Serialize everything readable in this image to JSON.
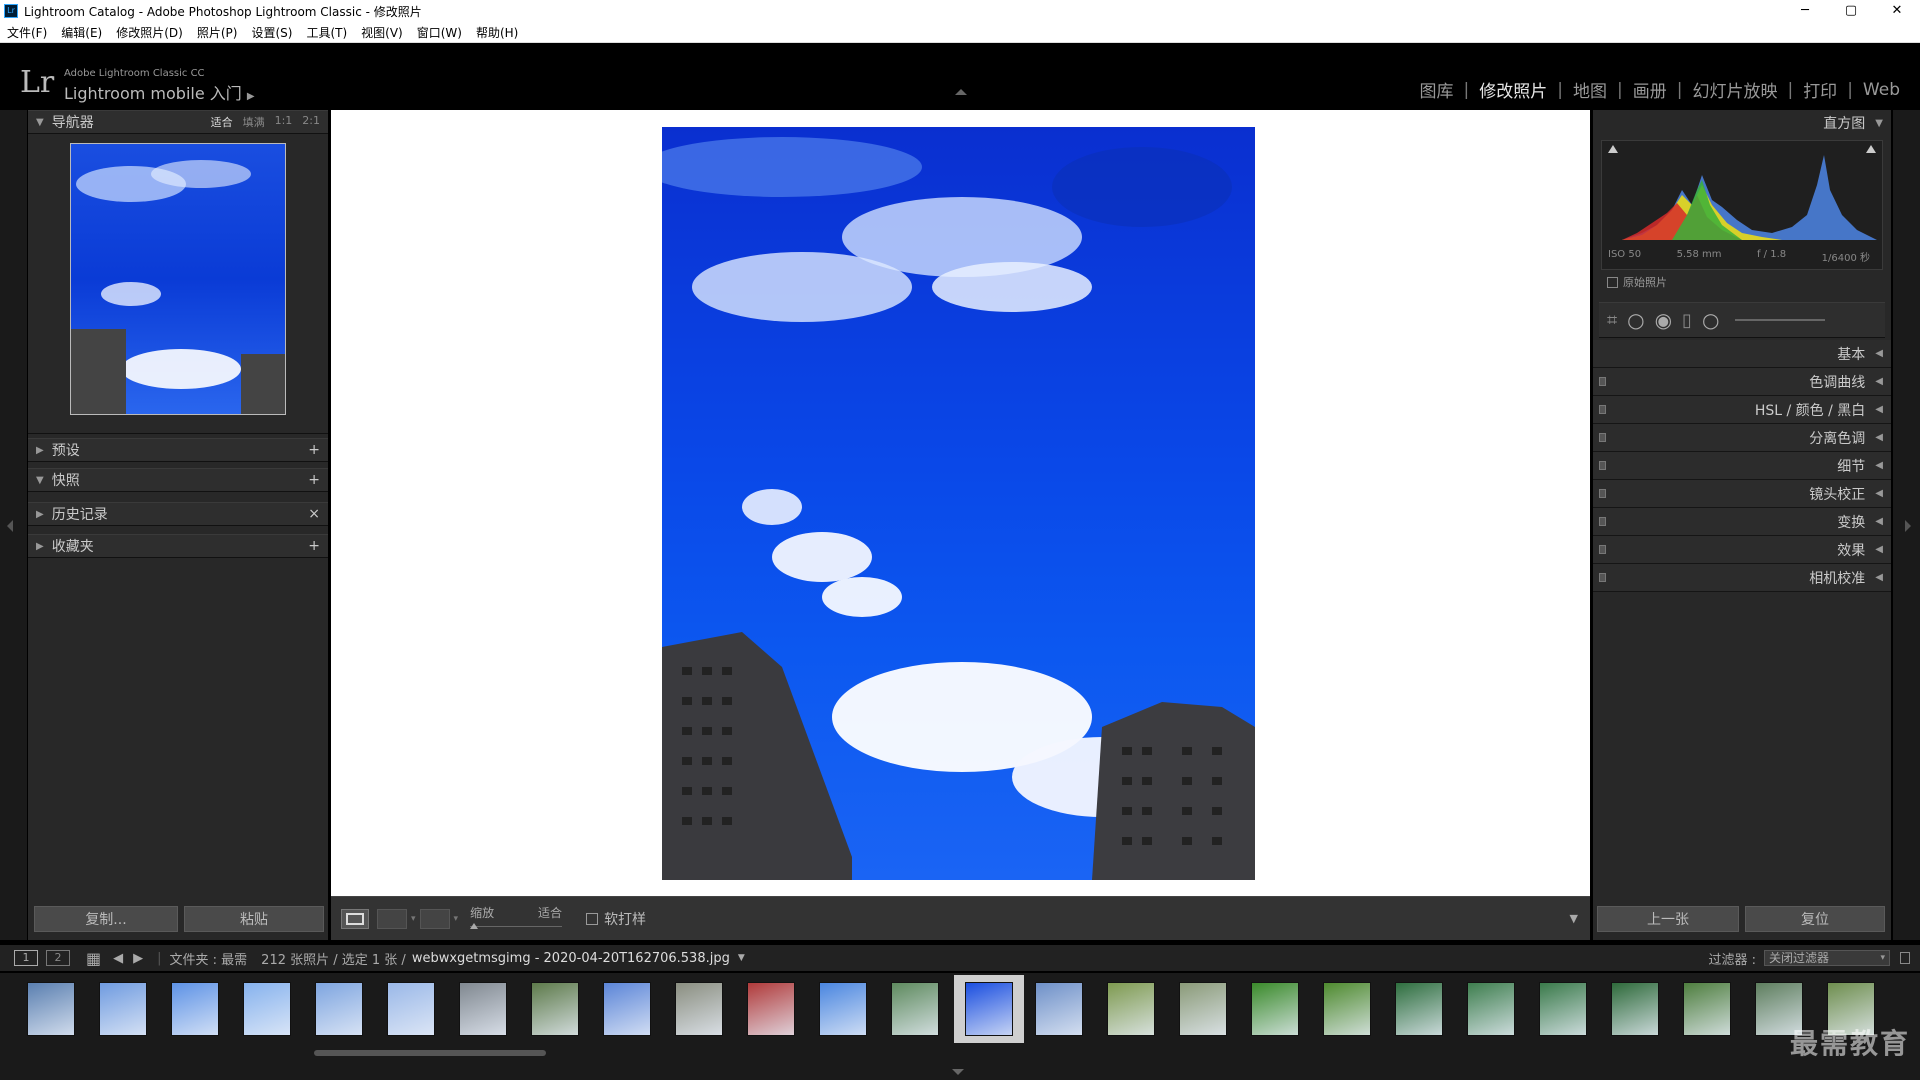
{
  "window": {
    "title": "Lightroom Catalog - Adobe Photoshop Lightroom Classic - 修改照片",
    "icon_label": "Lr",
    "minimize": "─",
    "maximize": "▢",
    "close": "✕"
  },
  "menu": [
    "文件(F)",
    "编辑(E)",
    "修改照片(D)",
    "照片(P)",
    "设置(S)",
    "工具(T)",
    "视图(V)",
    "窗口(W)",
    "帮助(H)"
  ],
  "identity": {
    "logo": "Lr",
    "line1": "Adobe Lightroom Classic CC",
    "line2": "Lightroom mobile 入门"
  },
  "modules": [
    {
      "label": "图库",
      "active": false
    },
    {
      "label": "修改照片",
      "active": true
    },
    {
      "label": "地图",
      "active": false
    },
    {
      "label": "画册",
      "active": false
    },
    {
      "label": "幻灯片放映",
      "active": false
    },
    {
      "label": "打印",
      "active": false
    },
    {
      "label": "Web",
      "active": false
    }
  ],
  "left": {
    "navigator": {
      "title": "导航器",
      "opts": [
        "适合",
        "填满",
        "1:1",
        "2:1"
      ]
    },
    "panels": [
      {
        "label": "预设",
        "action": "+"
      },
      {
        "label": "快照",
        "action": "+"
      },
      {
        "label": "历史记录",
        "action": "×"
      },
      {
        "label": "收藏夹",
        "action": "+"
      }
    ],
    "copy_btn": "复制...",
    "paste_btn": "粘贴"
  },
  "toolbar": {
    "zoom_label": "缩放",
    "zoom_value": "适合",
    "softproof": "软打样"
  },
  "right": {
    "histogram_title": "直方图",
    "exif": {
      "iso": "ISO 50",
      "focal": "5.58 mm",
      "aperture": "f / 1.8",
      "shutter": "1/6400 秒"
    },
    "original_photo": "原始照片",
    "panels": [
      {
        "label": "基本",
        "switch": false
      },
      {
        "label": "色调曲线",
        "switch": true
      },
      {
        "label": "HSL  /  颜色  /  黑白",
        "switch": true
      },
      {
        "label": "分离色调",
        "switch": true
      },
      {
        "label": "细节",
        "switch": true
      },
      {
        "label": "镜头校正",
        "switch": true
      },
      {
        "label": "变换",
        "switch": true
      },
      {
        "label": "效果",
        "switch": true
      },
      {
        "label": "相机校准",
        "switch": true
      }
    ],
    "prev_btn": "上一张",
    "reset_btn": "复位"
  },
  "filmstrip_header": {
    "page1": "1",
    "page2": "2",
    "source": "文件夹 : 最需",
    "count": "212 张照片 / 选定 1 张 /",
    "filename": "webwxgetmsgimg - 2020-04-20T162706.538.jpg",
    "filter_label": "过滤器 :",
    "filter_value": "关闭过滤器"
  },
  "watermark": "最需教育",
  "colors": {
    "accent_blue": "#0a48e8",
    "panel_bg": "#282828",
    "active_text": "#e6e6e6"
  }
}
